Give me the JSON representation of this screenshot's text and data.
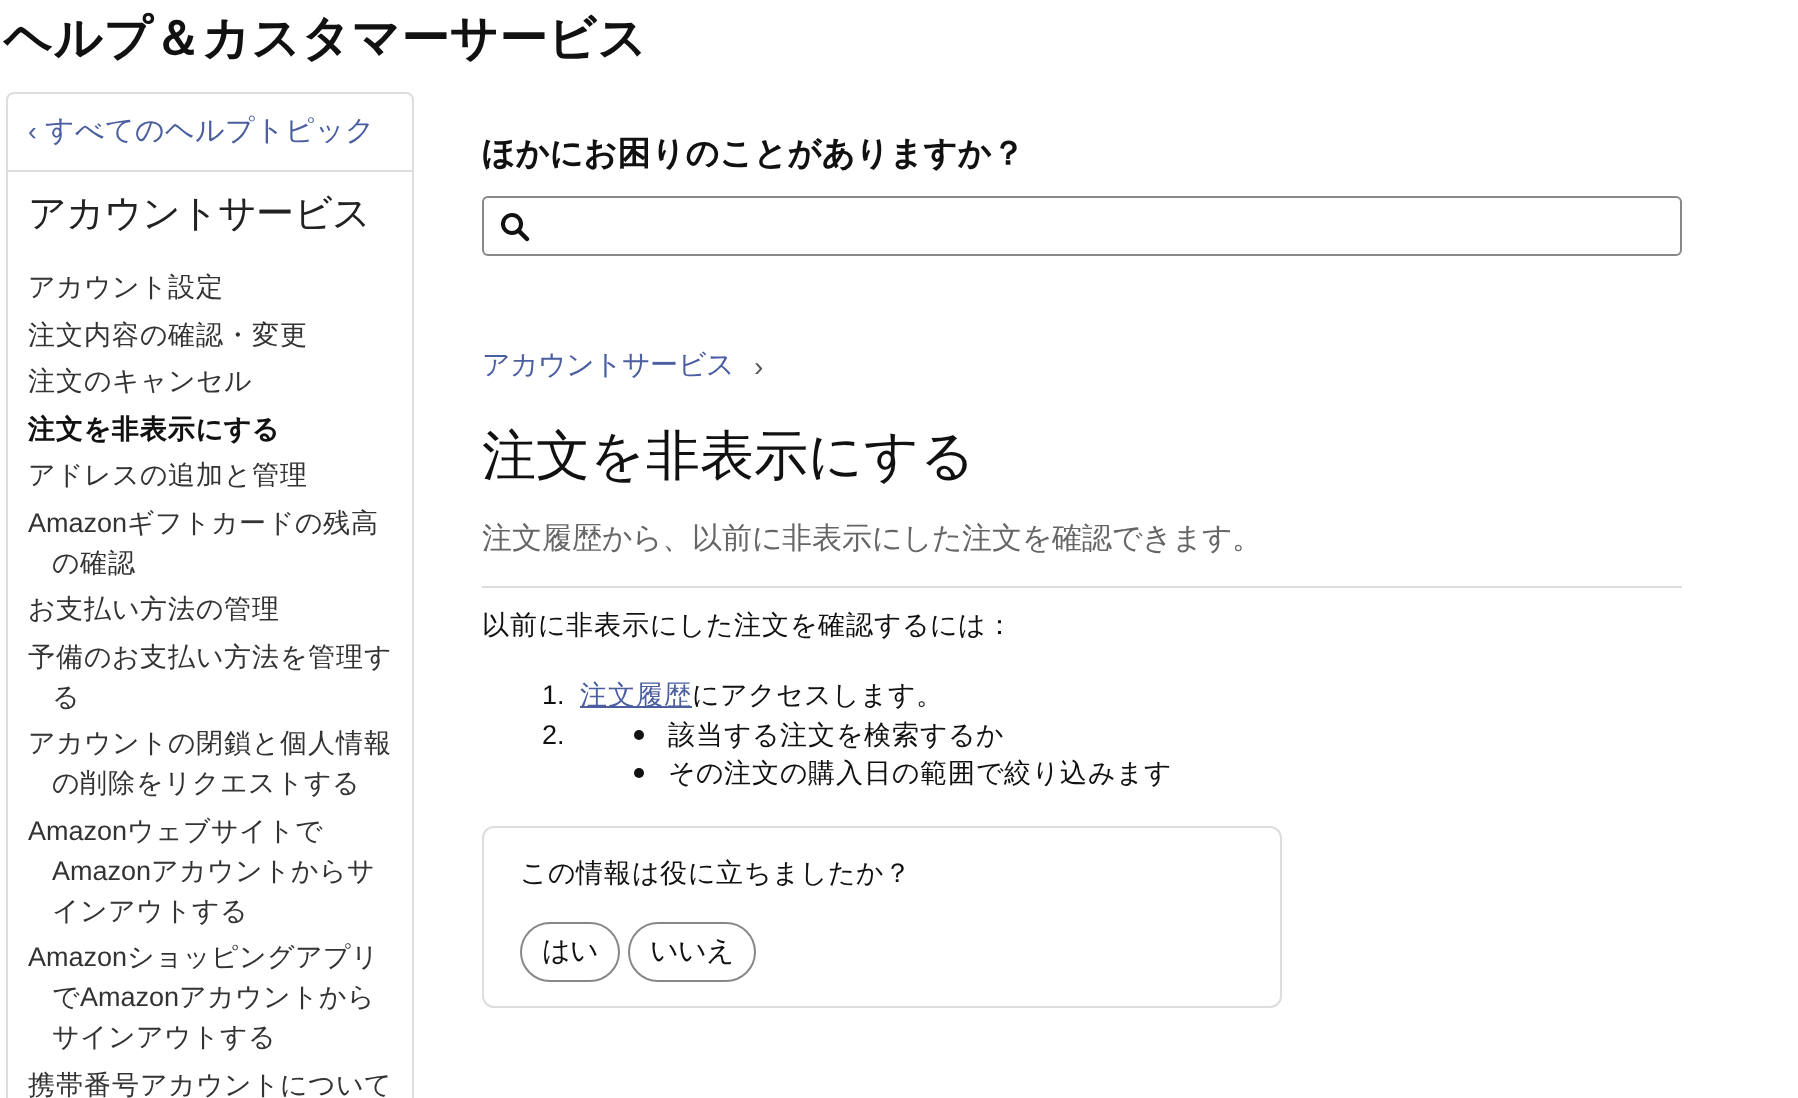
{
  "page_title": "ヘルプ＆カスタマーサービス",
  "sidebar": {
    "back_link": {
      "icon": "‹",
      "label": "すべてのヘルプトピック"
    },
    "heading": "アカウントサービス",
    "items": [
      {
        "label": "アカウント設定",
        "selected": false
      },
      {
        "label": "注文内容の確認・変更",
        "selected": false
      },
      {
        "label": "注文のキャンセル",
        "selected": false
      },
      {
        "label": "注文を非表示にする",
        "selected": true
      },
      {
        "label": "アドレスの追加と管理",
        "selected": false
      },
      {
        "label": "Amazonギフトカードの残高の確認",
        "selected": false
      },
      {
        "label": "お支払い方法の管理",
        "selected": false
      },
      {
        "label": "予備のお支払い方法を管理する",
        "selected": false
      },
      {
        "label": "アカウントの閉鎖と個人情報の削除をリクエストする",
        "selected": false
      },
      {
        "label": "AmazonウェブサイトでAmazonアカウントからサインアウトする",
        "selected": false
      },
      {
        "label": "AmazonショッピングアプリでAmazonアカウントからサインアウトする",
        "selected": false
      },
      {
        "label": "携帯番号アカウントについて",
        "selected": false
      }
    ]
  },
  "search": {
    "heading": "ほかにお困りのことがありますか？"
  },
  "breadcrumb": {
    "label": "アカウントサービス",
    "separator": "›"
  },
  "article": {
    "title": "注文を非表示にする",
    "lead": "注文履歴から、以前に非表示にした注文を確認できます。",
    "intro": "以前に非表示にした注文を確認するには：",
    "steps": [
      {
        "number": "1.",
        "link": "注文履歴",
        "text": "にアクセスします。"
      },
      {
        "number": "2.",
        "bullets": [
          "該当する注文を検索するか",
          "その注文の購入日の範囲で絞り込みます"
        ]
      }
    ]
  },
  "feedback": {
    "question": "この情報は役に立ちましたか？",
    "buttons": [
      "はい",
      "いいえ"
    ]
  }
}
